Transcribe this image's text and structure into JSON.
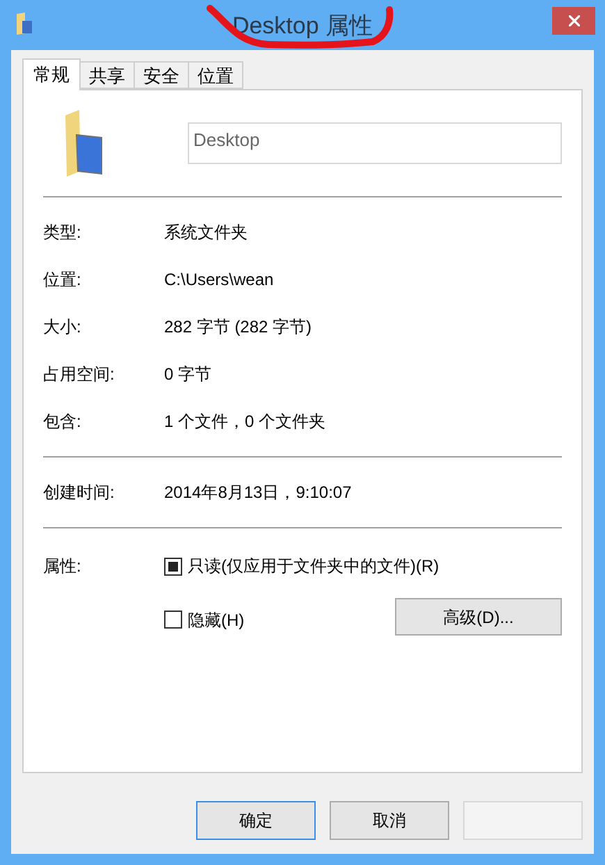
{
  "window": {
    "title": "Desktop 属性"
  },
  "tabs": [
    {
      "label": "常规",
      "selected": true
    },
    {
      "label": "共享",
      "selected": false
    },
    {
      "label": "安全",
      "selected": false
    },
    {
      "label": "位置",
      "selected": false
    }
  ],
  "name_field": {
    "value": "Desktop"
  },
  "groups": [
    [
      {
        "label": "类型:",
        "value": "系统文件夹"
      },
      {
        "label": "位置:",
        "value": "C:\\Users\\wean"
      },
      {
        "label": "大小:",
        "value": "282 字节 (282 字节)"
      },
      {
        "label": "占用空间:",
        "value": "0 字节"
      },
      {
        "label": "包含:",
        "value": "1 个文件，0 个文件夹"
      }
    ],
    [
      {
        "label": "创建时间:",
        "value": "2014年8月13日，9:10:07"
      }
    ]
  ],
  "attributes": {
    "label": "属性:",
    "options": [
      {
        "label": "只读(仅应用于文件夹中的文件)(R)",
        "checked": false,
        "mixed": true
      },
      {
        "label": "隐藏(H)",
        "checked": false,
        "mixed": false
      }
    ],
    "advanced_button": "高级(D)..."
  },
  "buttons": [
    {
      "label": "确定",
      "default": true,
      "disabled": false
    },
    {
      "label": "取消",
      "default": false,
      "disabled": false
    },
    {
      "default": false,
      "disabled": true
    }
  ]
}
